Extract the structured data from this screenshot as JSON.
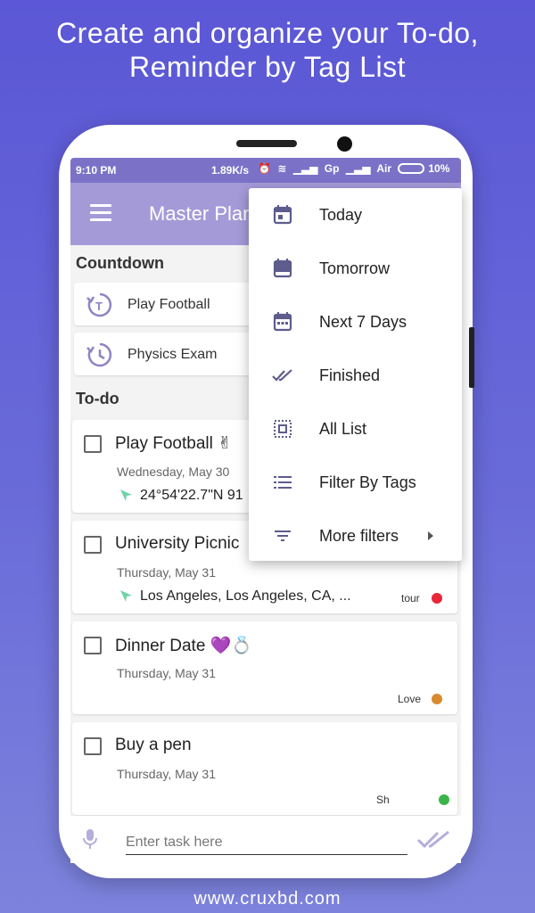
{
  "headline": {
    "line1": "Create and organize your To-do,",
    "line2": "Reminder by Tag List"
  },
  "footer_url": "www.cruxbd.com",
  "status_bar": {
    "time": "9:10 PM",
    "network_speed": "1.89K/s",
    "carrier": "Gp",
    "carrier2": "Air",
    "battery": "10%"
  },
  "app_bar": {
    "title": "Master Planner"
  },
  "countdown": {
    "section_title": "Countdown",
    "items": [
      {
        "label": "Play Football",
        "icon": "history-t-icon"
      },
      {
        "label": "Physics Exam",
        "icon": "history-icon"
      }
    ]
  },
  "todo": {
    "section_title": "To-do",
    "items": [
      {
        "title": "Play Football ✌",
        "date": "Wednesday, May 30",
        "location": "24°54'22.7\"N 91",
        "tag": "",
        "tag_color": ""
      },
      {
        "title": "University Picnic",
        "date": "Thursday, May 31",
        "location": "Los Angeles, Los Angeles, CA, ...",
        "tag": "tour",
        "tag_color": "#e8263a"
      },
      {
        "title": "Dinner Date 💜💍",
        "date": "Thursday, May 31",
        "location": "",
        "tag": "Love",
        "tag_color": "#d98a30"
      },
      {
        "title": "Buy a pen",
        "date": "Thursday, May 31",
        "location": "",
        "tag": "Sh",
        "tag_color": "#3bb54a"
      }
    ]
  },
  "menu": {
    "items": [
      {
        "label": "Today",
        "icon": "calendar-today-icon"
      },
      {
        "label": "Tomorrow",
        "icon": "calendar-tomorrow-icon"
      },
      {
        "label": "Next 7 Days",
        "icon": "calendar-week-icon"
      },
      {
        "label": "Finished",
        "icon": "double-check-icon"
      },
      {
        "label": "All List",
        "icon": "select-all-icon"
      },
      {
        "label": "Filter By Tags",
        "icon": "list-icon"
      },
      {
        "label": "More filters",
        "icon": "filter-icon"
      }
    ]
  },
  "bottom_bar": {
    "input_placeholder": "Enter task here"
  },
  "colors": {
    "background": "#5b57d6",
    "app_bar": "#a59ad8",
    "status_bar": "#7b72c8",
    "accent": "#9f8fd9",
    "icon": "#5d5c8c"
  }
}
